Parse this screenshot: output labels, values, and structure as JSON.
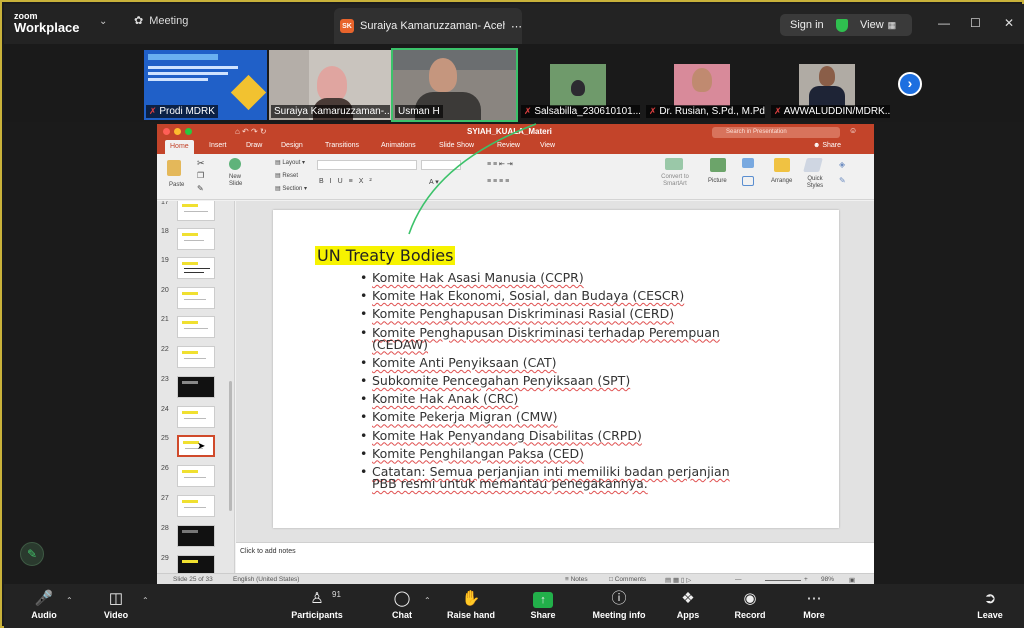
{
  "app": {
    "logo_small": "zoom",
    "logo_big": "Workplace",
    "meeting_tab": "Meeting",
    "active_tab_badge": "SK",
    "active_tab_title": "Suraiya Kamaruzzaman- Aceh's sc",
    "sign_in": "Sign in",
    "view": "View"
  },
  "participants": [
    {
      "name": "Prodi MDRK",
      "muted": true
    },
    {
      "name": "Suraiya Kamaruzzaman-...",
      "muted": false
    },
    {
      "name": "Usman H",
      "muted": false,
      "active": true
    },
    {
      "name": "Salsabilla_230610101...",
      "muted": true
    },
    {
      "name": "Dr. Rusian, S.Pd., M.Pd.",
      "muted": true
    },
    {
      "name": "AWWALUDDIN/MDRK...",
      "muted": true
    }
  ],
  "powerpoint": {
    "filename": "SYIAH_KUALA_Materi",
    "search_placeholder": "Search in Presentation",
    "tabs": [
      "Home",
      "Insert",
      "Draw",
      "Design",
      "Transitions",
      "Animations",
      "Slide Show",
      "Review",
      "View"
    ],
    "share": "Share",
    "ribbon": {
      "paste": "Paste",
      "new_slide": "New Slide",
      "layout": "Layout",
      "reset": "Reset",
      "section": "Section",
      "convert": "Convert to SmartArt",
      "picture": "Picture",
      "arrange": "Arrange",
      "quick_styles": "Quick Styles"
    },
    "slide_numbers": [
      "17",
      "18",
      "19",
      "20",
      "21",
      "22",
      "23",
      "24",
      "25",
      "26",
      "27",
      "28",
      "29"
    ],
    "slide": {
      "heading": "UN Treaty Bodies",
      "bullets": [
        "Komite Hak Asasi Manusia (CCPR)",
        "Komite Hak Ekonomi, Sosial, dan Budaya (CESCR)",
        "Komite Penghapusan Diskriminasi Rasial (CERD)",
        "Komite Penghapusan Diskriminasi terhadap Perempuan (CEDAW)",
        "Komite Anti Penyiksaan (CAT)",
        "Subkomite Pencegahan Penyiksaan (SPT)",
        "Komite Hak Anak (CRC)",
        "Komite Pekerja Migran (CMW)",
        "Komite Hak Penyandang Disabilitas (CRPD)",
        "Komite Penghilangan Paksa (CED)",
        "Catatan: Semua perjanjian inti memiliki badan perjanjian PBB resmi untuk memantau penegakannya."
      ]
    },
    "notes_placeholder": "Click to add notes",
    "status": {
      "slide_info": "Slide 25 of 33",
      "language": "English (United States)",
      "notes": "Notes",
      "comments": "Comments",
      "zoom": "98%"
    }
  },
  "toolbar": {
    "audio": "Audio",
    "video": "Video",
    "participants": "Participants",
    "participant_count": "91",
    "chat": "Chat",
    "raise_hand": "Raise hand",
    "share": "Share",
    "meeting_info": "Meeting info",
    "apps": "Apps",
    "record": "Record",
    "more": "More",
    "leave": "Leave"
  },
  "colors": {
    "ppt_accent": "#c3442a",
    "zoom_share_green": "#22b04a",
    "active_speaker": "#3bc26a",
    "heading_highlight": "#f7f300"
  }
}
